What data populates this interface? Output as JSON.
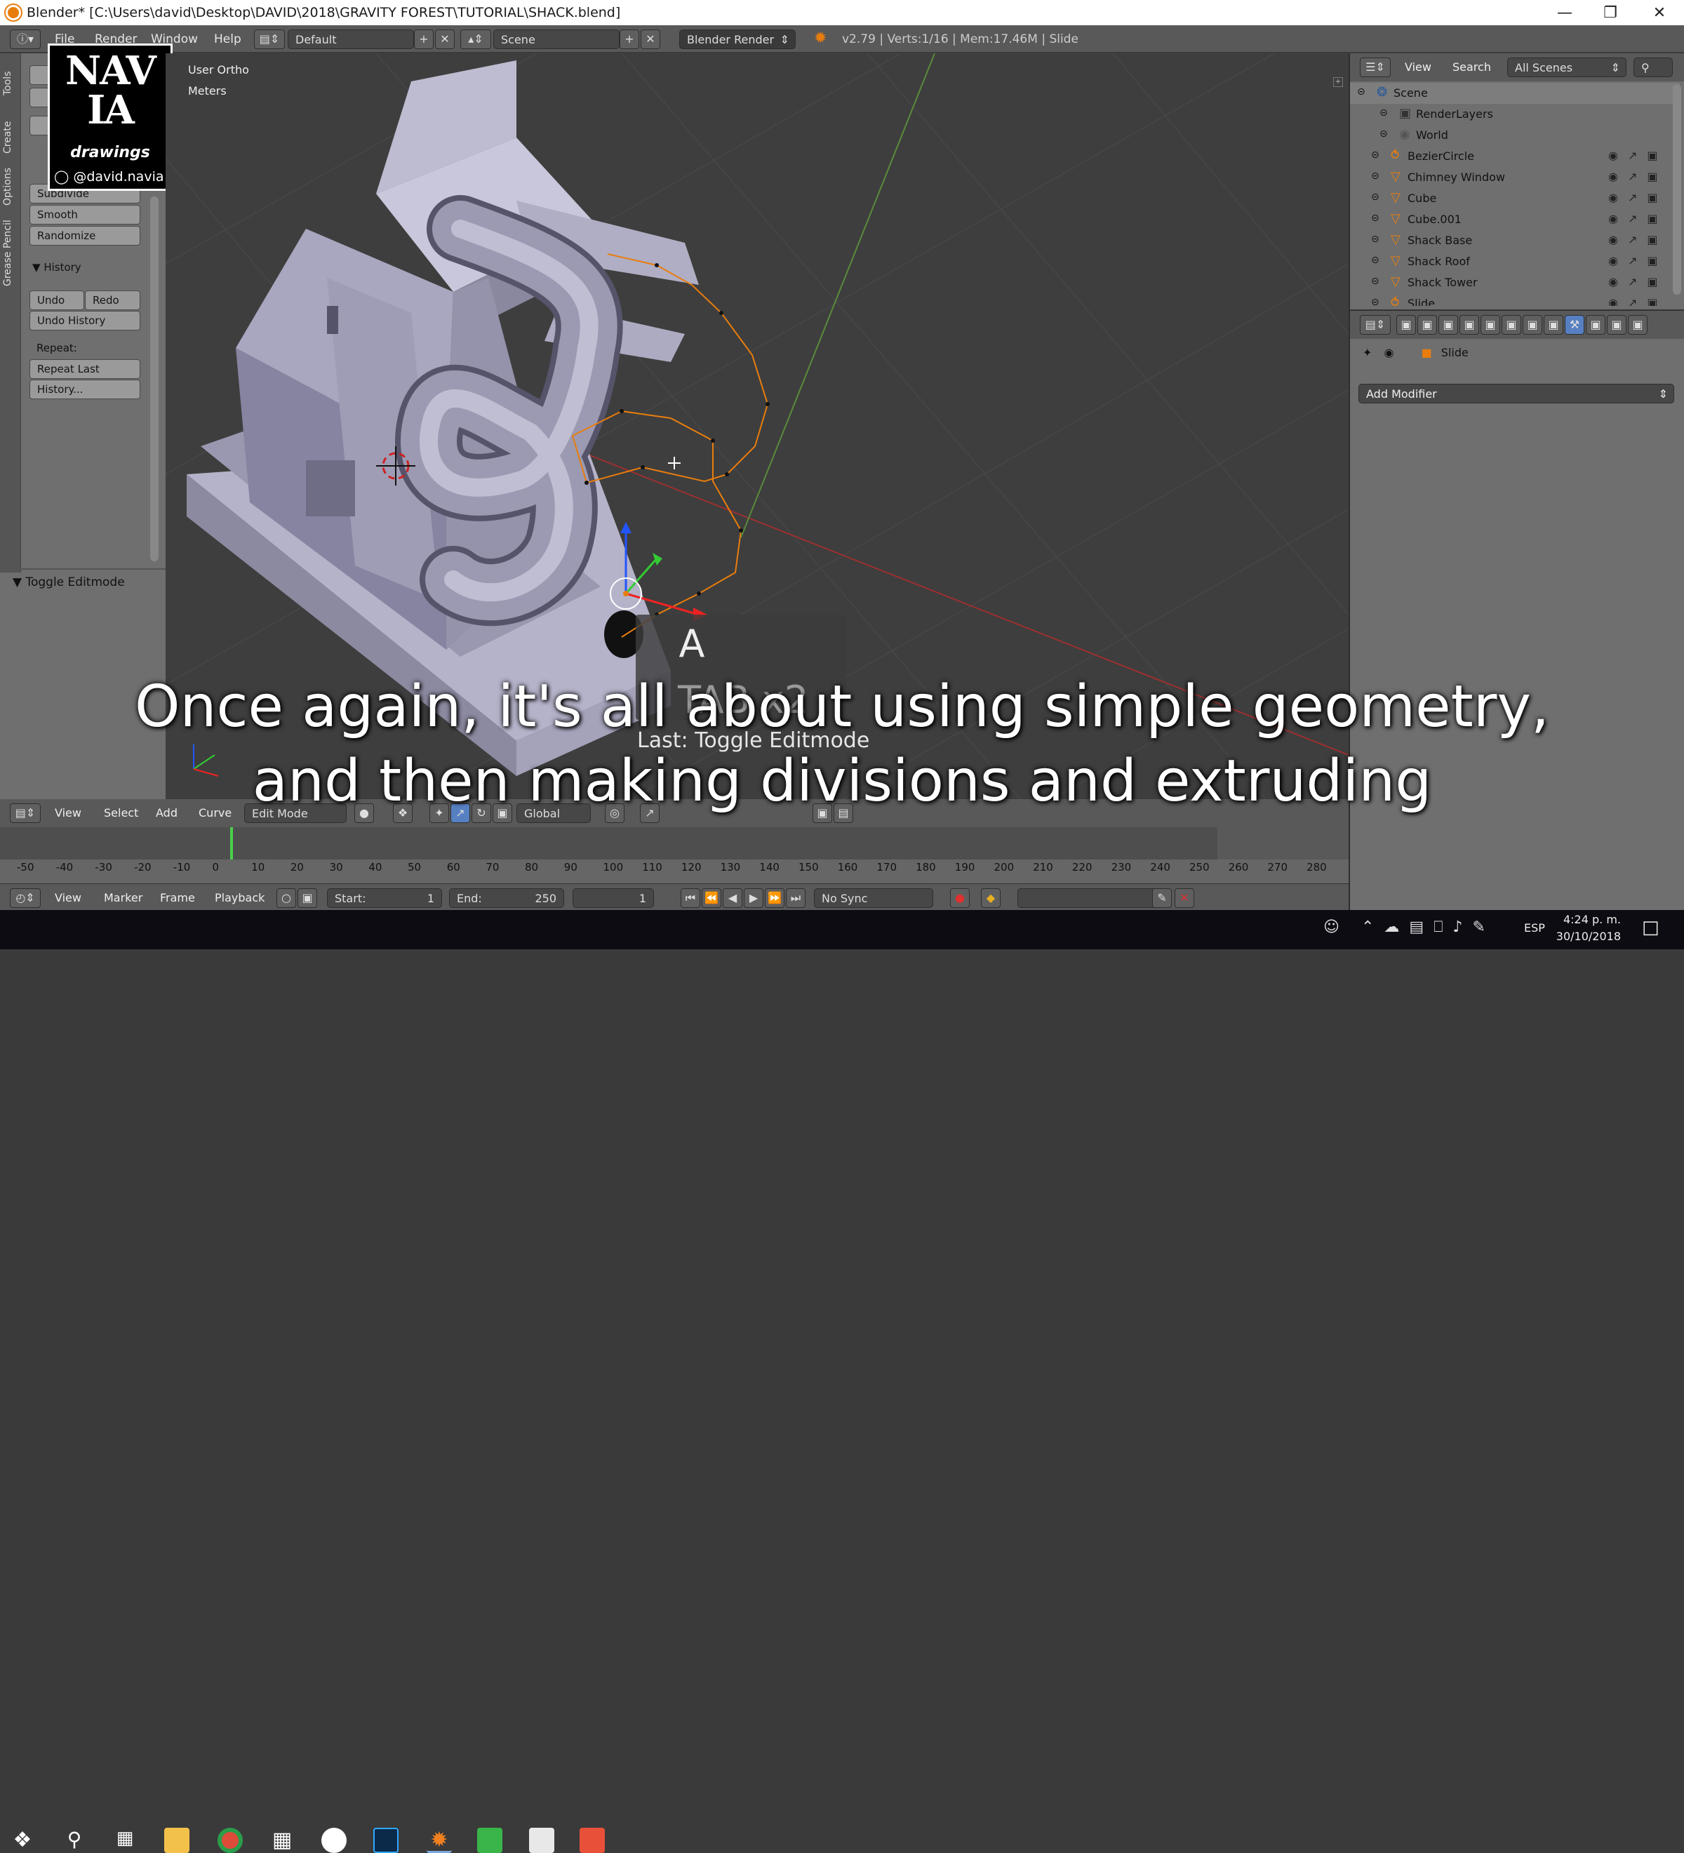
{
  "window": {
    "title": "Blender* [C:\\Users\\david\\Desktop\\DAVID\\2018\\GRAVITY FOREST\\TUTORIAL\\SHACK.blend]"
  },
  "menu": {
    "file": "File",
    "render": "Render",
    "window": "Window",
    "help": "Help"
  },
  "infobar": {
    "layout": "Default",
    "scene": "Scene",
    "engine": "Blender Render",
    "stats": "v2.79 | Verts:1/16 | Mem:17.46M | Slide"
  },
  "toolshelf": {
    "tabs": [
      "Tools",
      "Create",
      "Options",
      "Grease Pencil"
    ],
    "buttons": [
      "Subdivide",
      "Smooth",
      "Randomize"
    ],
    "history_header": "History",
    "undo": "Undo",
    "redo": "Redo",
    "undo_history": "Undo History",
    "repeat_label": "Repeat:",
    "repeat_last": "Repeat Last",
    "history": "History...",
    "operator_panel": "Toggle Editmode"
  },
  "watermark": {
    "logo_text": "NAVIA drawings",
    "handle": "@david.navia"
  },
  "viewport": {
    "view_name": "User Ortho",
    "units": "Meters",
    "key_overlay": {
      "key1": "A",
      "key2": "TAB x2",
      "last": "Last: Toggle Editmode"
    },
    "header": {
      "view": "View",
      "select": "Select",
      "add": "Add",
      "curve": "Curve",
      "mode": "Edit Mode",
      "orientation": "Global"
    }
  },
  "outliner": {
    "view": "View",
    "search": "Search",
    "scope": "All Scenes",
    "items": [
      {
        "name": "Scene",
        "type": "scene"
      },
      {
        "name": "RenderLayers",
        "type": "renderlayers"
      },
      {
        "name": "World",
        "type": "world"
      },
      {
        "name": "BezierCircle",
        "type": "curve"
      },
      {
        "name": "Chimney Window",
        "type": "mesh"
      },
      {
        "name": "Cube",
        "type": "mesh"
      },
      {
        "name": "Cube.001",
        "type": "mesh"
      },
      {
        "name": "Shack Base",
        "type": "mesh"
      },
      {
        "name": "Shack Roof",
        "type": "mesh"
      },
      {
        "name": "Shack Tower",
        "type": "mesh"
      },
      {
        "name": "Slide",
        "type": "curve"
      }
    ]
  },
  "properties": {
    "object": "Slide",
    "add_modifier": "Add Modifier"
  },
  "timeline": {
    "ticks": [
      "-50",
      "-40",
      "-30",
      "-20",
      "-10",
      "0",
      "10",
      "20",
      "30",
      "40",
      "50",
      "60",
      "70",
      "80",
      "90",
      "100",
      "110",
      "120",
      "130",
      "140",
      "150",
      "160",
      "170",
      "180",
      "190",
      "200",
      "210",
      "220",
      "230",
      "240",
      "250",
      "260",
      "270",
      "280"
    ],
    "view": "View",
    "marker": "Marker",
    "frame": "Frame",
    "playback": "Playback",
    "start_label": "Start:",
    "start": "1",
    "end_label": "End:",
    "end": "250",
    "current": "1",
    "sync": "No Sync"
  },
  "subtitle": {
    "line1": "Once again, it's all about using simple geometry,",
    "line2": "and then making divisions and extruding"
  },
  "taskbar": {
    "lang": "ESP",
    "time": "4:24 p. m.",
    "date": "30/10/2018"
  },
  "colors": {
    "viewport_bg": "#3e3e3e",
    "panel_bg": "#6f6f6f",
    "header_bg": "#595959",
    "select_orange": "#e87d0d",
    "mesh": "#8e8ca8"
  }
}
